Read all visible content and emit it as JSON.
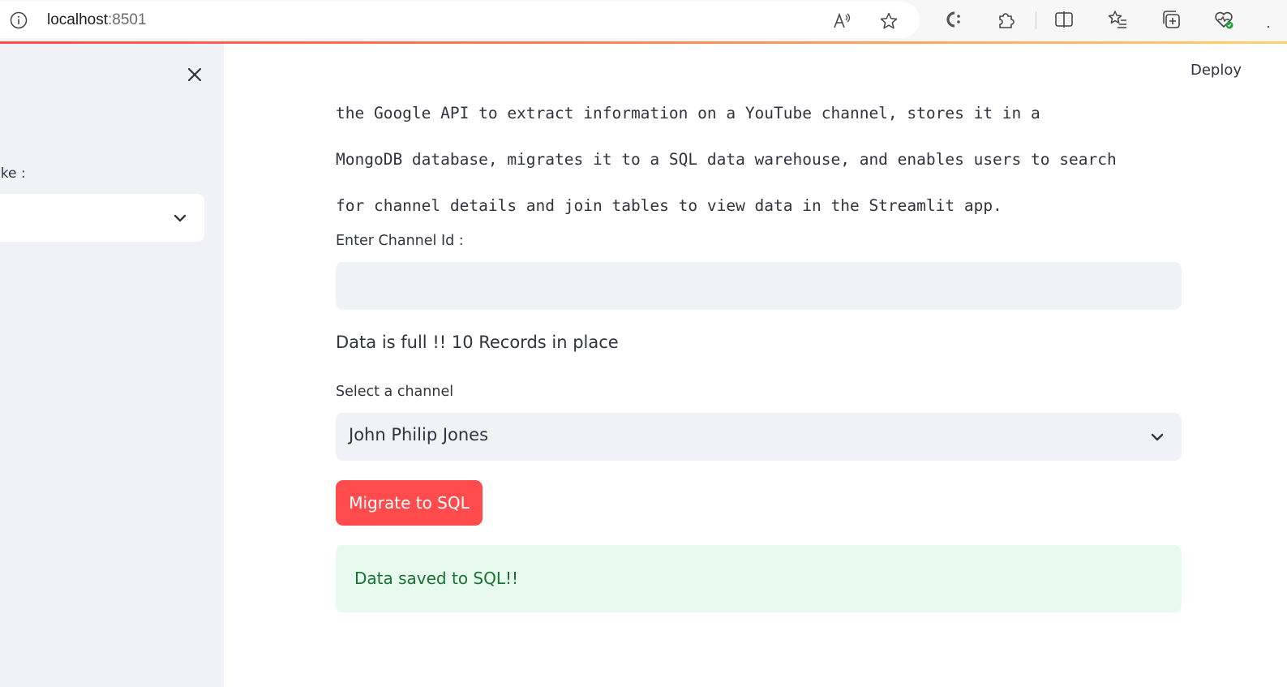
{
  "browser": {
    "url_host": "localhost",
    "url_port": ":8501",
    "icons": {
      "info": "info-icon",
      "read_aloud": "read-aloud-icon",
      "favorite": "star-icon",
      "copilot": "copilot-icon",
      "extensions": "puzzle-icon",
      "split_screen": "split-screen-icon",
      "favorites_bar": "favorites-icon",
      "collections": "collections-icon",
      "health": "browser-essentials-icon"
    },
    "more": "·"
  },
  "sidebar": {
    "label": "ike :",
    "select_value": "",
    "close_icon": "close-icon"
  },
  "header": {
    "deploy_label": "Deploy"
  },
  "main": {
    "description_lines": [
      "the Google API to extract information on a YouTube channel, stores it in a",
      "MongoDB database, migrates it to a SQL data warehouse, and enables users to search",
      "for channel details and join tables to view data in the Streamlit app."
    ],
    "channel_id_label": "Enter Channel Id :",
    "channel_id_value": "",
    "status_text": "Data is full !! 10 Records in place",
    "select_label": "Select a channel",
    "select_value": "John Philip Jones",
    "migrate_button": "Migrate to SQL",
    "success_message": "Data saved to SQL!!"
  },
  "colors": {
    "primary": "#ff4b4b",
    "sidebar_bg": "#f0f2f6",
    "input_bg": "#f0f2f6",
    "success_bg": "#e8f9ee",
    "success_text": "#177233",
    "text": "#31333f"
  }
}
